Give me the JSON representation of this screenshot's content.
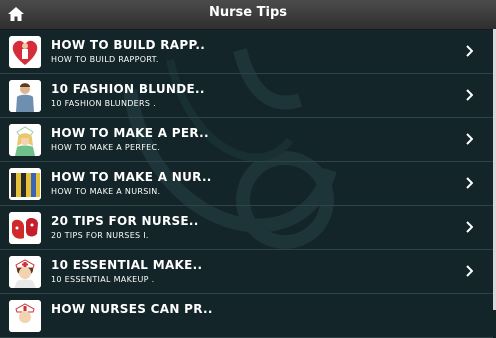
{
  "app": {
    "title": "Nurse Tips"
  },
  "colors": {
    "background": "#132528",
    "topbar": "#3d3d3d",
    "text": "#ffffff"
  },
  "items": [
    {
      "title": "HOW TO BUILD RAPP..",
      "subtitle": "HOW TO BUILD RAPPORT.",
      "icon": "nurse-heart-icon"
    },
    {
      "title": "10 FASHION BLUNDE..",
      "subtitle": "10 FASHION BLUNDERS .",
      "icon": "nurse-scrubs-icon"
    },
    {
      "title": "HOW TO MAKE A PER..",
      "subtitle": "HOW TO MAKE A PERFEC.",
      "icon": "nurse-character-icon"
    },
    {
      "title": "HOW TO MAKE A NUR..",
      "subtitle": "HOW TO MAKE A NURSIN.",
      "icon": "binders-icon"
    },
    {
      "title": "20 TIPS FOR NURSE..",
      "subtitle": "20 TIPS FOR NURSES I.",
      "icon": "shoes-icon"
    },
    {
      "title": "10 ESSENTIAL MAKE..",
      "subtitle": "10 ESSENTIAL MAKEUP .",
      "icon": "nurse-face-icon"
    },
    {
      "title": "HOW NURSES CAN PR..",
      "subtitle": "",
      "icon": "nurse-partial-icon"
    }
  ]
}
